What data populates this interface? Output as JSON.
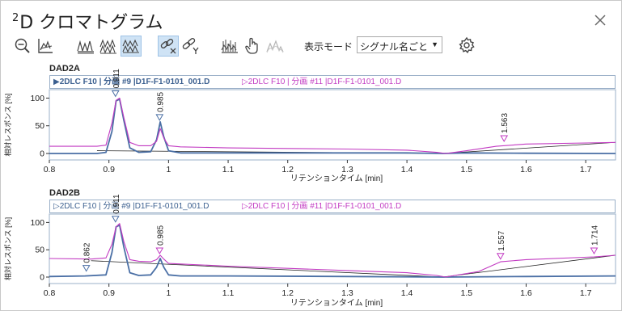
{
  "window": {
    "title_sup": "2",
    "title": "D クロマトグラム"
  },
  "toolbar": {
    "mode_label": "表示モード",
    "mode_value": "シグナル名ごと",
    "icons": [
      "zoom-out-icon",
      "baseline-icon",
      "overlay-1-icon",
      "overlay-2-icon",
      "overlay-3-icon",
      "unlink-x-icon",
      "link-y-icon",
      "peaks-icon",
      "hand-cursor-icon",
      "smooth-icon",
      "gear-icon"
    ]
  },
  "panels": [
    {
      "title": "DAD2A",
      "legend": [
        {
          "marker": "▶",
          "text": "2DLC F10 | 分画 #9 |D1F-F1-0101_001.D",
          "color": "#3b5f8f",
          "bold": true
        },
        {
          "marker": "▷",
          "text": "2DLC F10 | 分画 #11 |D1F-F1-0101_001.D",
          "color": "#c23ac2",
          "bold": false
        }
      ],
      "ylabel": "相対レスポンス [%]",
      "xlabel": "リテンションタイム [min]"
    },
    {
      "title": "DAD2B",
      "legend": [
        {
          "marker": "▷",
          "text": "2DLC F10 | 分画 #9 |D1F-F1-0101_001.D",
          "color": "#3b5f8f",
          "bold": false
        },
        {
          "marker": "▷",
          "text": "2DLC F10 | 分画 #11 |D1F-F1-0101_001.D",
          "color": "#c23ac2",
          "bold": false
        }
      ],
      "ylabel": "相対レスポンス [%]",
      "xlabel": "リテンションタイム [min]"
    }
  ],
  "chart_data": [
    {
      "type": "line",
      "title": "DAD2A",
      "xlabel": "リテンションタイム [min]",
      "ylabel": "相対レスポンス [%]",
      "xlim": [
        0.8,
        1.75
      ],
      "ylim": [
        0,
        105
      ],
      "xticks": [
        "0.8",
        "0.9",
        "1",
        "1.1",
        "1.2",
        "1.3",
        "1.4",
        "1.5",
        "1.6",
        "1.7"
      ],
      "yticks": [
        "0",
        "50",
        "100"
      ],
      "series": [
        {
          "name": "2DLC F10 | 分画 #9 |D1F-F1-0101_001.D",
          "color": "#4a6fa5",
          "x": [
            0.8,
            0.88,
            0.895,
            0.905,
            0.912,
            0.918,
            0.925,
            0.935,
            0.95,
            0.97,
            0.98,
            0.986,
            0.992,
            1.0,
            1.02,
            1.1,
            1.3,
            1.4,
            1.46,
            1.5,
            1.6,
            1.75
          ],
          "y": [
            0,
            0,
            2,
            40,
            95,
            98,
            60,
            10,
            2,
            3,
            25,
            57,
            30,
            5,
            1,
            1,
            1,
            1,
            0,
            1,
            0.5,
            0
          ]
        },
        {
          "name": "2DLC F10 | 分画 #11 |D1F-F1-0101_001.D",
          "color": "#c23ac2",
          "x": [
            0.8,
            0.88,
            0.895,
            0.905,
            0.912,
            0.918,
            0.925,
            0.935,
            0.95,
            0.97,
            0.98,
            0.986,
            0.992,
            1.0,
            1.02,
            1.1,
            1.2,
            1.3,
            1.4,
            1.45,
            1.465,
            1.48,
            1.5,
            1.55,
            1.6,
            1.7,
            1.75
          ],
          "y": [
            13,
            13,
            15,
            55,
            96,
            100,
            65,
            20,
            14,
            14,
            22,
            45,
            28,
            14,
            12,
            10,
            9,
            8,
            6,
            2,
            0,
            2,
            5,
            13,
            17,
            19,
            20
          ]
        }
      ],
      "annotations": [
        {
          "x": 0.911,
          "y": 100,
          "label": "0.911",
          "color": "#4a6fa5"
        },
        {
          "x": 0.985,
          "y": 57,
          "label": "0.985",
          "color": "#4a6fa5"
        },
        {
          "x": 1.563,
          "y": 19,
          "label": "1.563",
          "color": "#c23ac2"
        }
      ],
      "baselines": [
        {
          "x": [
            0.88,
            1.46
          ],
          "y": [
            5,
            0
          ]
        },
        {
          "x": [
            1.46,
            1.75
          ],
          "y": [
            0,
            20
          ]
        }
      ]
    },
    {
      "type": "line",
      "title": "DAD2B",
      "xlabel": "リテンションタイム [min]",
      "ylabel": "相対レスポンス [%]",
      "xlim": [
        0.8,
        1.75
      ],
      "ylim": [
        0,
        105
      ],
      "xticks": [
        "0.8",
        "0.9",
        "1",
        "1.1",
        "1.2",
        "1.3",
        "1.4",
        "1.5",
        "1.6",
        "1.7"
      ],
      "yticks": [
        "0",
        "50",
        "100"
      ],
      "series": [
        {
          "name": "2DLC F10 | 分画 #9 |D1F-F1-0101_001.D",
          "color": "#4a6fa5",
          "x": [
            0.8,
            0.86,
            0.895,
            0.905,
            0.912,
            0.918,
            0.925,
            0.935,
            0.95,
            0.97,
            0.98,
            0.986,
            0.992,
            1.0,
            1.02,
            1.1,
            1.3,
            1.46,
            1.6,
            1.75
          ],
          "y": [
            1,
            2,
            4,
            45,
            92,
            95,
            55,
            8,
            3,
            4,
            18,
            34,
            18,
            4,
            2,
            2,
            1,
            0,
            1,
            2
          ]
        },
        {
          "name": "2DLC F10 | 分画 #11 |D1F-F1-0101_001.D",
          "color": "#c23ac2",
          "x": [
            0.8,
            0.87,
            0.895,
            0.905,
            0.912,
            0.918,
            0.925,
            0.935,
            0.95,
            0.97,
            0.98,
            0.986,
            0.992,
            1.0,
            1.02,
            1.1,
            1.2,
            1.3,
            1.4,
            1.45,
            1.465,
            1.48,
            1.52,
            1.557,
            1.6,
            1.714,
            1.75
          ],
          "y": [
            34,
            33,
            35,
            60,
            92,
            98,
            65,
            32,
            29,
            28,
            32,
            40,
            33,
            25,
            24,
            20,
            16,
            12,
            8,
            3,
            0,
            3,
            10,
            28,
            32,
            37,
            40
          ]
        }
      ],
      "annotations": [
        {
          "x": 0.862,
          "y": 8,
          "label": "0.862",
          "color": "#4a6fa5"
        },
        {
          "x": 0.911,
          "y": 98,
          "label": "0.911",
          "color": "#4a6fa5"
        },
        {
          "x": 0.985,
          "y": 40,
          "label": "0.985",
          "color": "#c23ac2"
        },
        {
          "x": 1.557,
          "y": 30,
          "label": "1.557",
          "color": "#c23ac2"
        },
        {
          "x": 1.714,
          "y": 40,
          "label": "1.714",
          "color": "#c23ac2"
        }
      ],
      "baselines": [
        {
          "x": [
            0.87,
            1.46
          ],
          "y": [
            30,
            0
          ]
        },
        {
          "x": [
            1.46,
            1.75
          ],
          "y": [
            0,
            40
          ]
        }
      ]
    }
  ]
}
